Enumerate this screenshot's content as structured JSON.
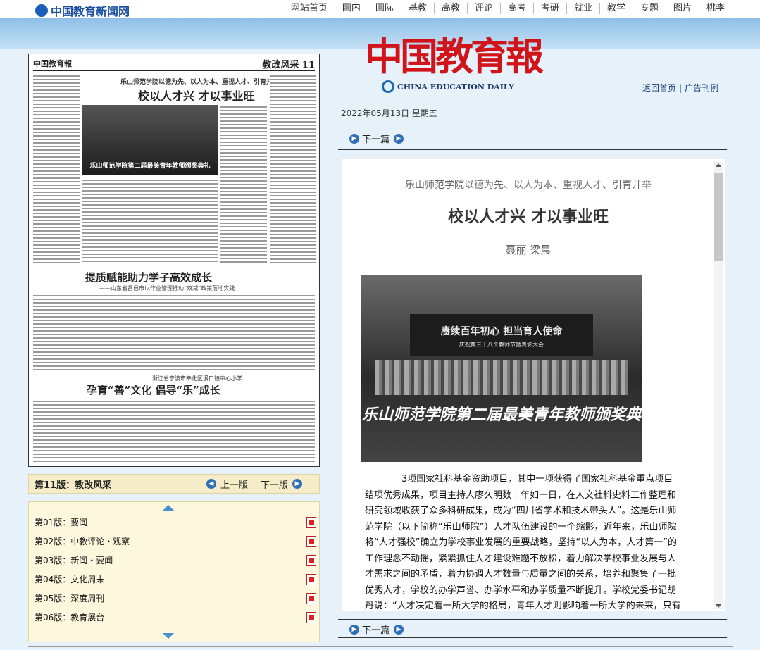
{
  "site": {
    "logo_text": "中国教育新闻网",
    "nav": [
      "网站首页",
      "国内",
      "国际",
      "基教",
      "高教",
      "评论",
      "高考",
      "考研",
      "就业",
      "教学",
      "专题",
      "图片",
      "桃李"
    ]
  },
  "masthead": {
    "title": "中国教育報",
    "subtitle": "CHINA EDUCATION DAILY",
    "links": [
      "返回首页",
      "广告刊例"
    ]
  },
  "date_line": "2022年05月13日 星期五",
  "article_nav": {
    "next_label": "下一篇"
  },
  "newspaper": {
    "page_number": "11",
    "section": "教改风采",
    "kicker": "乐山师范学院以德为先、以人为本、重视人才、引育并举",
    "title": "校以人才兴 才以事业旺",
    "photo_caption": "乐山师范学院第二届最美青年教师颁奖典礼",
    "headline2": "提质赋能助力学子高效成长",
    "subhead2": "——山东省昌邑市以作业管理推动“双减”政策落地实践",
    "kicker3": "浙江省宁波市奉化区溪口镇中心小学",
    "headline3": "孕育“善”文化 倡导“乐”成长"
  },
  "pagebar": {
    "current": "第11版：教改风采",
    "prev_label": "上一版",
    "next_label": "下一版"
  },
  "page_list": [
    "第01版：要闻",
    "第02版：中教评论・观察",
    "第03版：新闻・要闻",
    "第04版：文化周末",
    "第05版：深度周刊",
    "第06版：教育展台"
  ],
  "article": {
    "kicker": "乐山师范学院以德为先、以人为本、重视人才、引育并举",
    "title": "校以人才兴 才以事业旺",
    "authors": "聂丽 梁晨",
    "photo_screen_line1": "赓续百年初心 担当育人使命",
    "photo_screen_line2": "庆祝第三十八个教师节暨表彰大会",
    "photo_banner": "乐山师范学院第二届最美青年教师颁奖典",
    "body": "3项国家社科基金资助项目，其中一项获得了国家社科基金重点项目结项优秀成果，项目主持人廖久明数十年如一日，在人文社科史料工作整理和研究领域收获了众多科研成果，成为“四川省学术和技术带头人”。这是乐山师范学院（以下简称“乐山师院”）人才队伍建设的一个缩影，近年来，乐山师院将“人才强校”确立为学校事业发展的重要战略，坚持“以人为本，人才第一”的工作理念不动摇，紧紧抓住人才建设难题不放松，着力解决学校事业发展与人才需求之间的矛盾，着力协调人才数量与质量之间的关系，培养和聚集了一批优秀人才，学校的办学声誉、办学水平和办学质量不断提升。学校党委书记胡丹说：“人才决定着一所大学的格局，青年人才则影响着一所大学的未来，只有青年人才强起"
  },
  "colors": {
    "masthead_red": "#d0141a",
    "link_blue": "#1a3a7a",
    "pagebar_bg": "#f7ecc8",
    "page_bg": "#e6f1fa"
  }
}
